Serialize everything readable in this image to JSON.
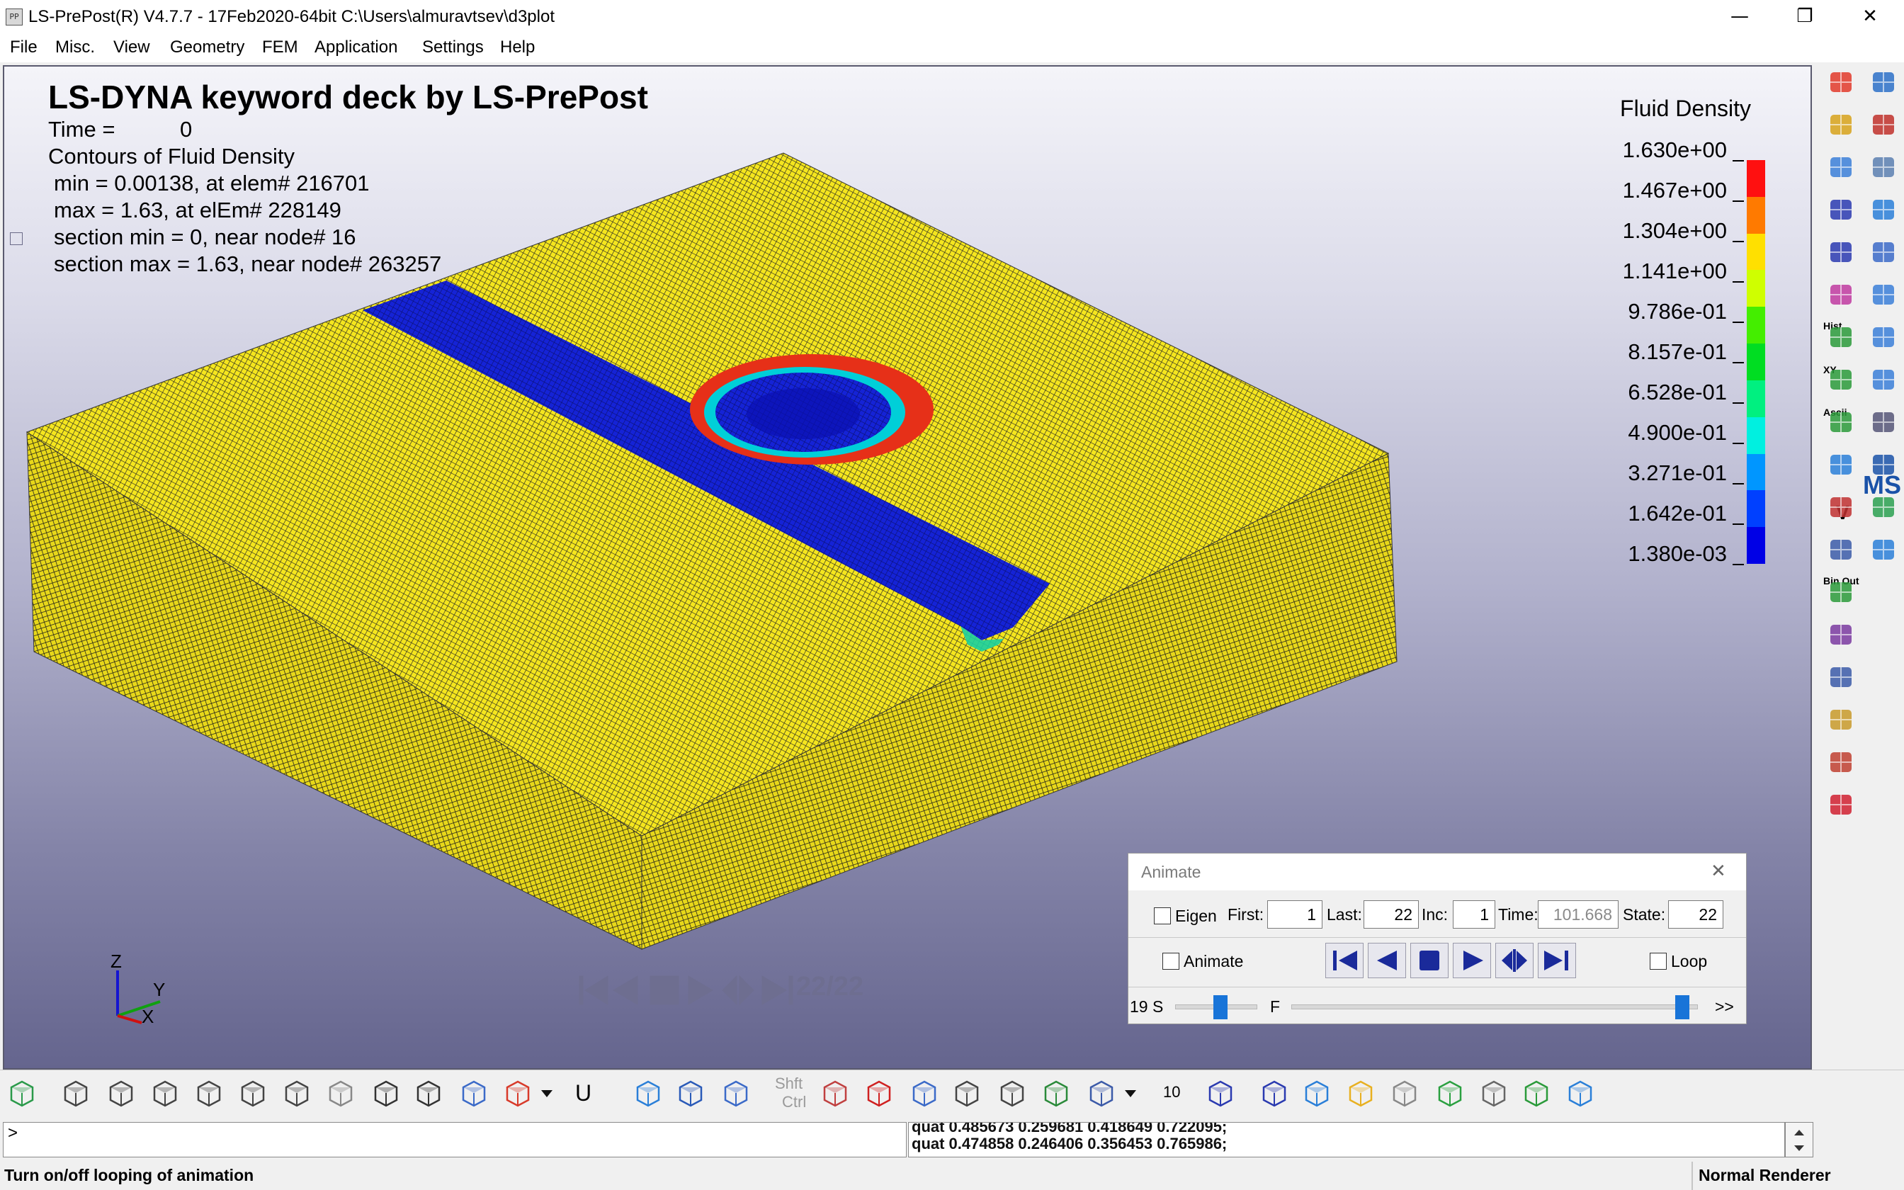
{
  "window": {
    "title": "LS-PrePost(R) V4.7.7 - 17Feb2020-64bit C:\\Users\\almuravtsev\\d3plot",
    "icon_text": "PP",
    "minimize_glyph": "—",
    "maximize_glyph": "❐",
    "close_glyph": "✕"
  },
  "menu": {
    "items": [
      "File",
      "Misc.",
      "View",
      "Geometry",
      "FEM",
      "Application",
      "Settings",
      "Help"
    ]
  },
  "viewport": {
    "title": "LS-DYNA keyword deck by LS-PrePost",
    "time_label": "Time =",
    "time_value": "0",
    "contour_label": "Contours of Fluid Density",
    "min_line": "min = 0.00138, at elem# 216701",
    "max_line": "max = 1.63, at elEm# 228149",
    "section_min_line": "section min = 0, near node# 16",
    "section_max_line": "section max = 1.63, near node# 263257",
    "frame_counter": "22/22",
    "triad": {
      "z": "Z",
      "y": "Y",
      "x": "X"
    },
    "mesh_color": "#f5e61e",
    "channel_color": "#1523d6"
  },
  "legend": {
    "title": "Fluid Density",
    "labels": [
      "1.630e+00",
      "1.467e+00",
      "1.304e+00",
      "1.141e+00",
      "9.786e-01",
      "8.157e-01",
      "6.528e-01",
      "4.900e-01",
      "3.271e-01",
      "1.642e-01",
      "1.380e-03"
    ],
    "colors": [
      "#ff1010",
      "#ff7a00",
      "#ffe000",
      "#cfff00",
      "#44ee00",
      "#00dd22",
      "#00f080",
      "#00f0e0",
      "#0096ff",
      "#0040ff",
      "#0000e6"
    ]
  },
  "animate_dialog": {
    "title": "Animate",
    "close_glyph": "✕",
    "eigen_label": "Eigen",
    "first_label": "First:",
    "first_value": "1",
    "last_label": "Last:",
    "last_value": "22",
    "inc_label": "Inc:",
    "inc_value": "1",
    "time_label": "Time:",
    "time_value": "101.668",
    "state_label": "State:",
    "state_value": "22",
    "animate_label": "Animate",
    "loop_label": "Loop",
    "speed_label": "19 S",
    "speed_end_label": "F",
    "more_label": ">>",
    "speed_level": 0.56,
    "frame_level": 1.0
  },
  "bottom_toolbar": {
    "u_label": "U",
    "shift_label": "Shft",
    "ctrl_label": "Ctrl",
    "ten_label": "10"
  },
  "command": {
    "prompt": ">",
    "output_lines": [
      "quat 0.485673 0.259681 0.418649 0.722095;",
      "quat 0.474858 0.246406 0.356453 0.765986;"
    ]
  },
  "status": {
    "message": "Turn on/off looping of animation",
    "renderer": "Normal Renderer"
  },
  "right_toolbar": {
    "labels": {
      "hist": "Hist",
      "xy": "XY",
      "ascii": "Ascii",
      "binout": "Bin Out",
      "ms": "MS",
      "v": "V"
    }
  }
}
